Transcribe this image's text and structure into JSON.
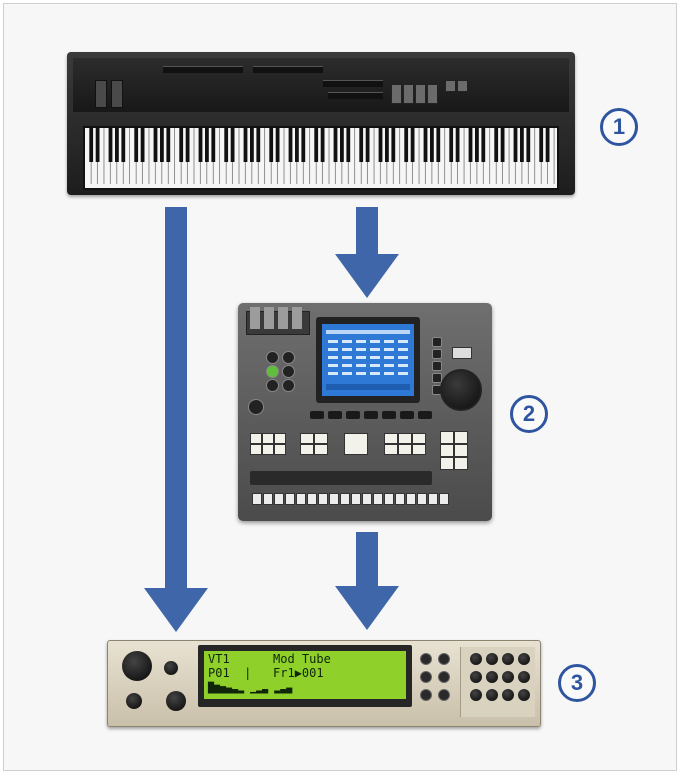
{
  "labels": {
    "device_1": "1",
    "device_2": "2",
    "device_3": "3"
  },
  "devices": [
    {
      "id": "keyboard",
      "icon": "midi-keyboard-icon"
    },
    {
      "id": "sequencer",
      "icon": "sequencer-workstation-icon"
    },
    {
      "id": "synth",
      "icon": "sound-module-icon"
    }
  ],
  "synth_display": {
    "line1": "VT1      Mod Tube",
    "line2": "P01  |   Fr1▶001",
    "line3": "█▆▅▄▃▂ ▁▂▃ ▂▃▄"
  },
  "colors": {
    "arrow": "#3f66a8",
    "label_ring": "#2f55a0",
    "lcd": "#8fd12a",
    "sequencer_screen": "#2f79d6"
  }
}
